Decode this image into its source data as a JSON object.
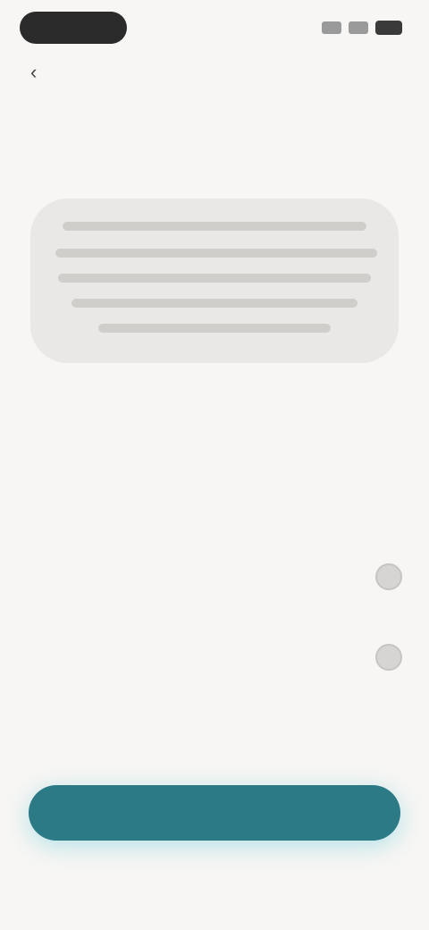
{
  "status_bar": {
    "time": "",
    "signal_icon": "signal-icon",
    "wifi_icon": "wifi-icon",
    "battery_icon": "battery-icon"
  },
  "header": {
    "back_icon": "arrow-left-icon",
    "back_glyph": "‹",
    "title": ""
  },
  "info_card": {
    "text": ""
  },
  "description": {
    "paragraph_1": "",
    "paragraph_2": ""
  },
  "options": [
    {
      "label": ""
    },
    {
      "label": ""
    }
  ],
  "link": {
    "label": ""
  },
  "primary_button": {
    "label": ""
  },
  "colors": {
    "background": "#f7f6f4",
    "card": "#e9e8e6",
    "accent": "#2b7a85",
    "button_glow": "#3cbed2"
  }
}
